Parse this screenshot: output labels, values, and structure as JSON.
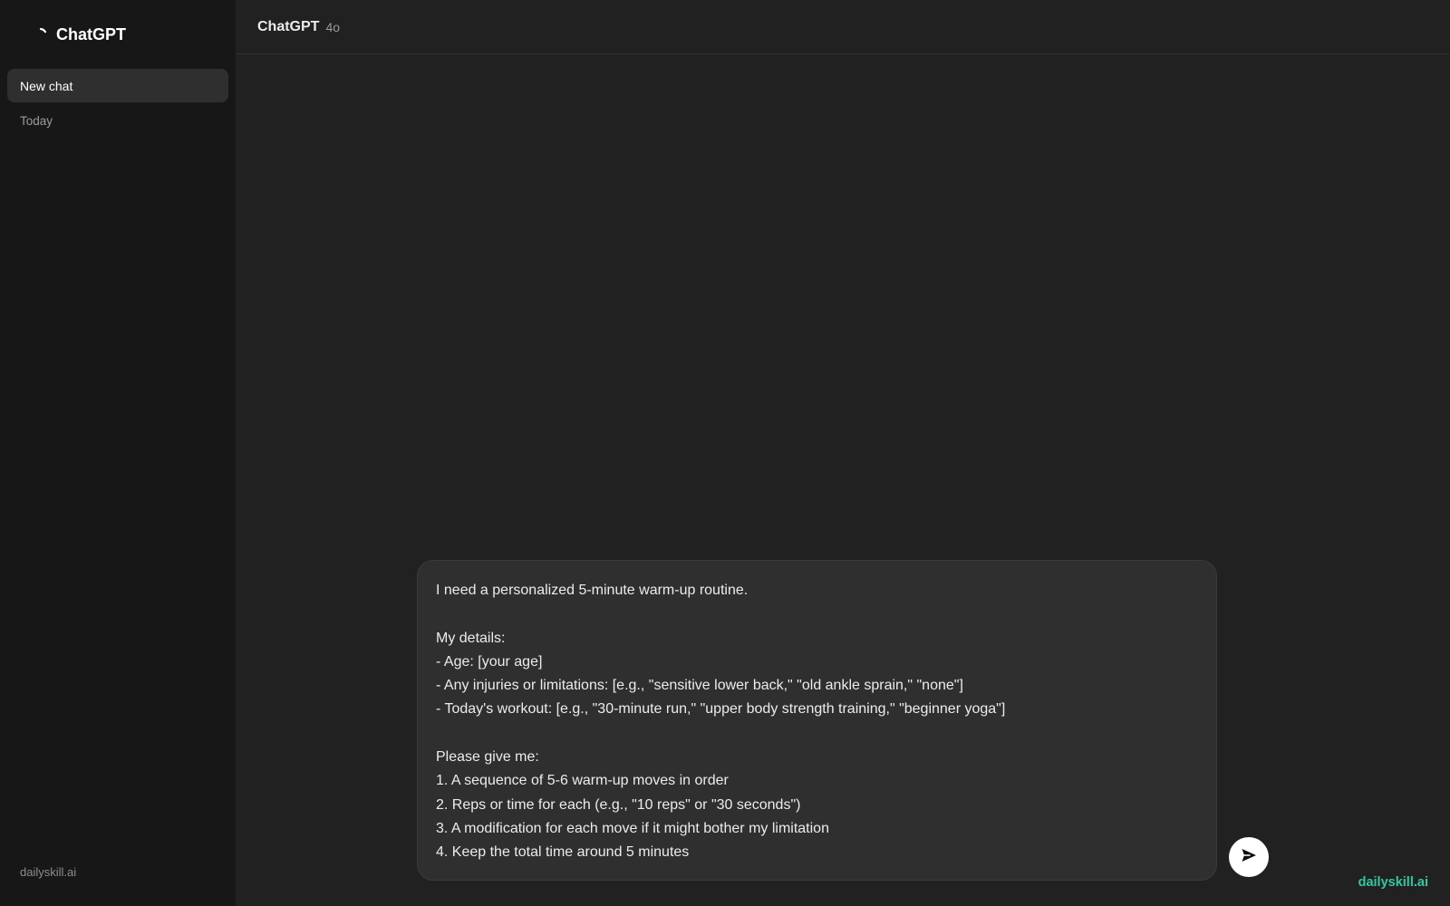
{
  "sidebar": {
    "brand": {
      "name": "ChatGPT",
      "icon": "spinner-icon"
    },
    "new_chat_label": "New chat",
    "section_label": "Today",
    "footer": "dailyskill.ai"
  },
  "header": {
    "model_name": "ChatGPT",
    "model_version": "4o"
  },
  "composer": {
    "text": "I need a personalized 5-minute warm-up routine.\n\nMy details:\n- Age: [your age]\n- Any injuries or limitations: [e.g., \"sensitive lower back,\" \"old ankle sprain,\" \"none\"]\n- Today's workout: [e.g., \"30-minute run,\" \"upper body strength training,\" \"beginner yoga\"]\n\nPlease give me:\n1. A sequence of 5-6 warm-up moves in order\n2. Reps or time for each (e.g., \"10 reps\" or \"30 seconds\")\n3. A modification for each move if it might bother my limitation\n4. Keep the total time around 5 minutes",
    "send_icon": "send-icon"
  },
  "watermark": "dailyskill.ai",
  "colors": {
    "sidebar_bg": "#171717",
    "main_bg": "#212121",
    "composer_bg": "#2f2f2f",
    "accent": "#2fc9a4"
  }
}
